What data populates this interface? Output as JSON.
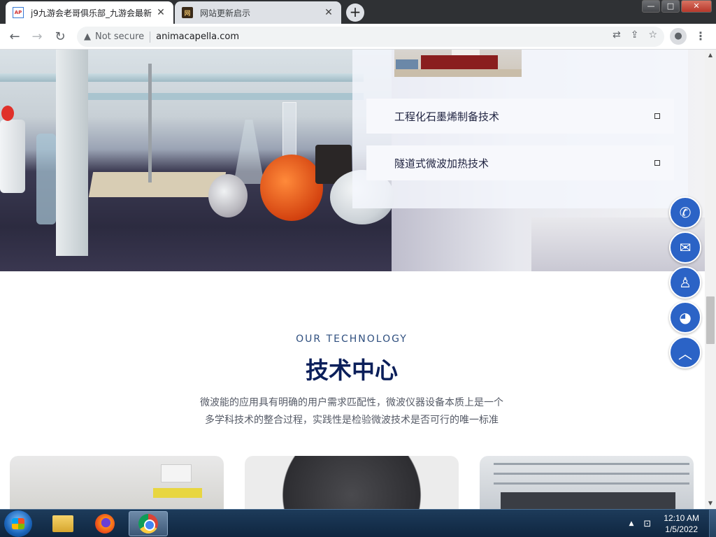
{
  "browser": {
    "tabs": [
      {
        "title": "j9九游会老哥俱乐部_九游会最新",
        "favicon": "AP",
        "active": true
      },
      {
        "title": "网站更新启示",
        "favicon": "网",
        "active": false
      }
    ],
    "new_tab_label": "+",
    "address": {
      "security_text": "Not secure",
      "url": "animacapella.com"
    },
    "window_buttons": {
      "minimize": "—",
      "maximize": "□",
      "close": "✕"
    }
  },
  "hero": {
    "accordion": [
      {
        "label": "工程化石墨烯制备技术"
      },
      {
        "label": "隧道式微波加热技术"
      }
    ]
  },
  "technology": {
    "subtitle": "OUR TECHNOLOGY",
    "title": "技术中心",
    "description_line1": "微波能的应用具有明确的用户需求匹配性，微波仪器设备本质上是一个",
    "description_line2": "多学科技术的整合过程，实践性是检验微波技术是否可行的唯一标准"
  },
  "floating_buttons": [
    {
      "name": "phone",
      "icon": "phone-icon",
      "glyph": "✆"
    },
    {
      "name": "email",
      "icon": "email-icon",
      "glyph": "✉"
    },
    {
      "name": "qq",
      "icon": "qq-icon",
      "glyph": "♙"
    },
    {
      "name": "wechat",
      "icon": "wechat-icon",
      "glyph": "◕"
    },
    {
      "name": "back-to-top",
      "icon": "chevron-up-icon",
      "glyph": "︿"
    }
  ],
  "taskbar": {
    "clock_time": "12:10 AM",
    "clock_date": "1/5/2022"
  },
  "colors": {
    "accent_blue": "#2b63c6",
    "title_navy": "#0b1f5a",
    "subtitle_blue": "#2f4f7f"
  }
}
